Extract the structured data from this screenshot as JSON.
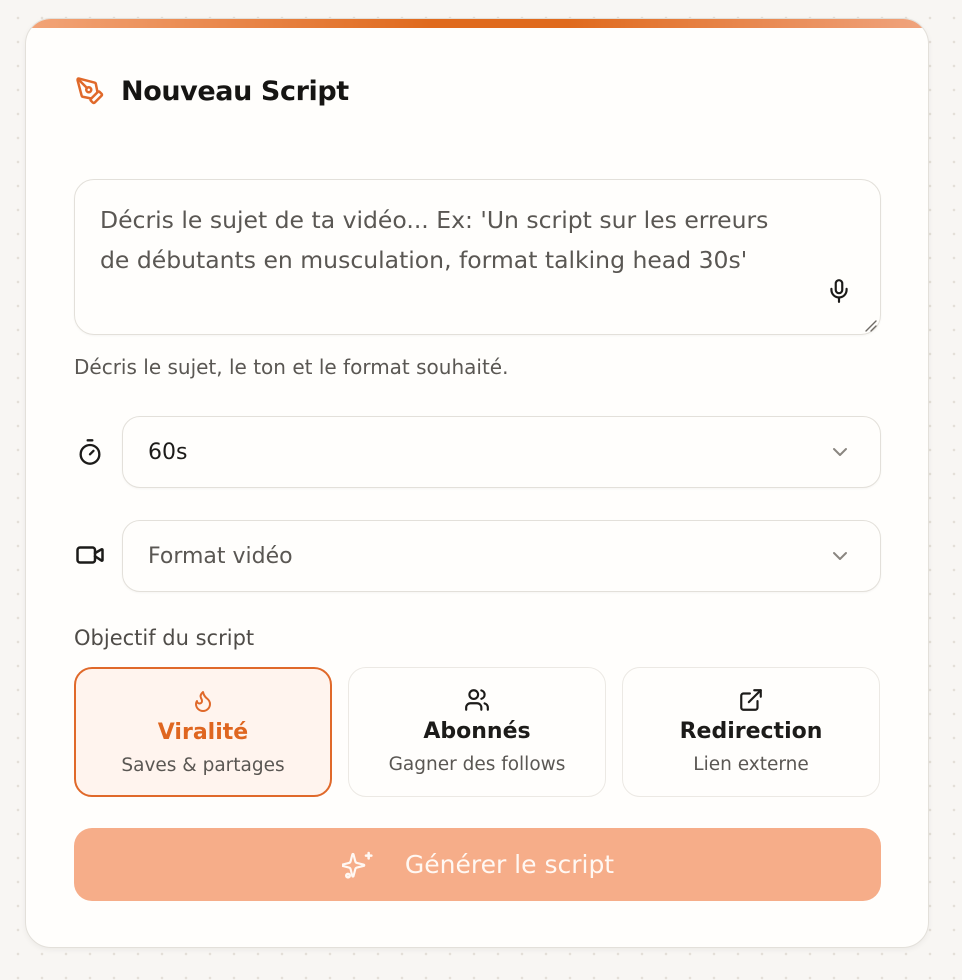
{
  "header": {
    "title": "Nouveau Script",
    "icon": "pen-tool-icon"
  },
  "prompt": {
    "value": "",
    "placeholder": "Décris le sujet de ta vidéo... Ex: 'Un script sur les erreurs de débutants en musculation, format talking head 30s'",
    "helper": "Décris le sujet, le ton et le format souhaité.",
    "mic_icon": "microphone-icon"
  },
  "duration": {
    "icon": "timer-icon",
    "selected": "60s"
  },
  "format": {
    "icon": "video-camera-icon",
    "selected": "Format vidéo"
  },
  "objective": {
    "label": "Objectif du script",
    "options": [
      {
        "title": "Viralité",
        "subtitle": "Saves & partages",
        "icon": "flame-icon",
        "selected": true
      },
      {
        "title": "Abonnés",
        "subtitle": "Gagner des follows",
        "icon": "users-icon",
        "selected": false
      },
      {
        "title": "Redirection",
        "subtitle": "Lien externe",
        "icon": "external-link-icon",
        "selected": false
      }
    ]
  },
  "generate": {
    "label": "Générer le script",
    "icon": "sparkles-icon"
  },
  "colors": {
    "accent": "#e0692a",
    "accent_light": "#fff4ee",
    "button_disabled": "#f6ad89",
    "card_background": "#fffefc",
    "page_background": "#f8f6f3",
    "border": "#e3e0da"
  }
}
